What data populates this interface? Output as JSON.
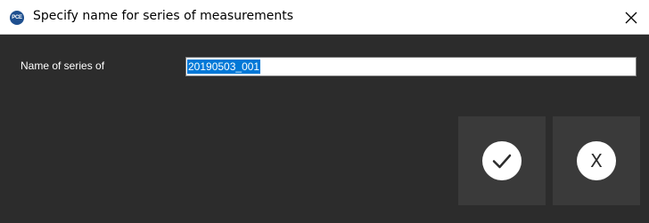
{
  "window": {
    "title": "Specify name for series of measurements",
    "app_icon_text": "PCE",
    "close_icon": "close-icon"
  },
  "form": {
    "label": "Name of series of",
    "value": "20190503_001"
  },
  "buttons": {
    "ok_icon": "checkmark-icon",
    "cancel_text": "X"
  },
  "colors": {
    "background": "#2c2c2c",
    "button": "#3a3a3a",
    "selection": "#0078d7"
  }
}
